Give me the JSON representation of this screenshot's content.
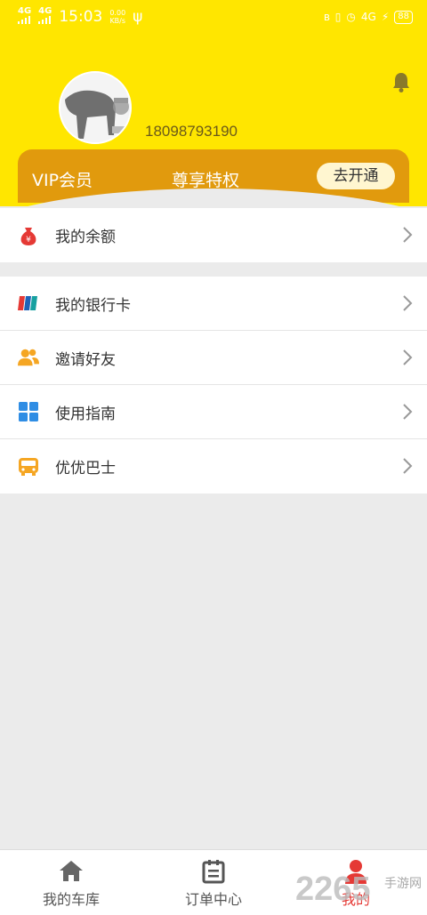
{
  "status_bar": {
    "signal1": "4G",
    "signal2": "4G",
    "time": "15:03",
    "speed_value": "0.00",
    "speed_unit": "KB/s",
    "network": "4G",
    "battery": "88"
  },
  "profile": {
    "phone": "18098793190"
  },
  "vip": {
    "label": "VIP会员",
    "subtitle": "尊享特权",
    "button": "去开通"
  },
  "menu_top": [
    {
      "label": "我的余额",
      "icon": "money-bag-icon"
    }
  ],
  "menu_main": [
    {
      "label": "我的银行卡",
      "icon": "bank-card-icon"
    },
    {
      "label": "邀请好友",
      "icon": "users-icon"
    },
    {
      "label": "使用指南",
      "icon": "grid-icon"
    },
    {
      "label": "优优巴士",
      "icon": "bus-icon"
    }
  ],
  "tabs": [
    {
      "label": "我的车库",
      "icon": "home-icon",
      "active": false
    },
    {
      "label": "订单中心",
      "icon": "clipboard-icon",
      "active": false
    },
    {
      "label": "我的",
      "icon": "person-icon",
      "active": true
    }
  ],
  "watermark": {
    "text1": "2265",
    "text2": "手游网"
  },
  "colors": {
    "header": "#ffe600",
    "vip_bar": "#e19a0d",
    "active_tab": "#e53935"
  }
}
